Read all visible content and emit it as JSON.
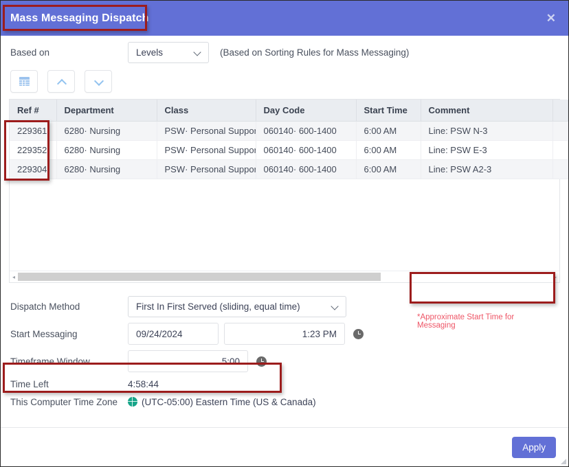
{
  "window": {
    "title": "Mass Messaging Dispatch",
    "close_label": "✕"
  },
  "based_on": {
    "label": "Based on",
    "value": "Levels",
    "note": "(Based on Sorting Rules for Mass Messaging)"
  },
  "toolbar": {
    "grid_button": "grid-view",
    "up_button": "move-up",
    "down_button": "move-down"
  },
  "grid": {
    "columns": [
      "Ref #",
      "Department",
      "Class",
      "Day Code",
      "Start Time",
      "Comment"
    ],
    "rows": [
      {
        "ref": "229361",
        "department": "6280· Nursing",
        "class": "PSW· Personal Support",
        "day_code": "060140· 600-1400",
        "start_time": "6:00 AM",
        "comment": "Line: PSW N-3"
      },
      {
        "ref": "229352",
        "department": "6280· Nursing",
        "class": "PSW· Personal Support",
        "day_code": "060140· 600-1400",
        "start_time": "6:00 AM",
        "comment": "Line: PSW E-3"
      },
      {
        "ref": "229304",
        "department": "6280· Nursing",
        "class": "PSW· Personal Support",
        "day_code": "060140· 600-1400",
        "start_time": "6:00 AM",
        "comment": "Line: PSW A2-3"
      }
    ],
    "scroll_left_arrow": "◂",
    "scroll_right_arrow": "▸"
  },
  "footnote": "*Approximate Start Time for Messaging",
  "form": {
    "dispatch_method_label": "Dispatch Method",
    "dispatch_method_value": "First In First Served (sliding, equal time)",
    "start_messaging_label": "Start Messaging",
    "start_messaging_date": "09/24/2024",
    "start_messaging_time": "1:23 PM",
    "timeframe_window_label": "Timeframe Window",
    "timeframe_window_value": "5:00",
    "time_left_label": "Time Left",
    "time_left_value": "4:58:44",
    "timezone_label": "This Computer Time Zone",
    "timezone_value": "(UTC-05:00) Eastern Time (US & Canada)"
  },
  "footer": {
    "apply_label": "Apply"
  },
  "colors": {
    "titlebar": "#6270d6",
    "accent_button": "#6270d6",
    "annotation": "#9c1c1c",
    "footnote_text": "#ee5566",
    "grid_header": "#eaedf1",
    "row_alt": "#f4f5f7",
    "globe": "#17a589"
  }
}
